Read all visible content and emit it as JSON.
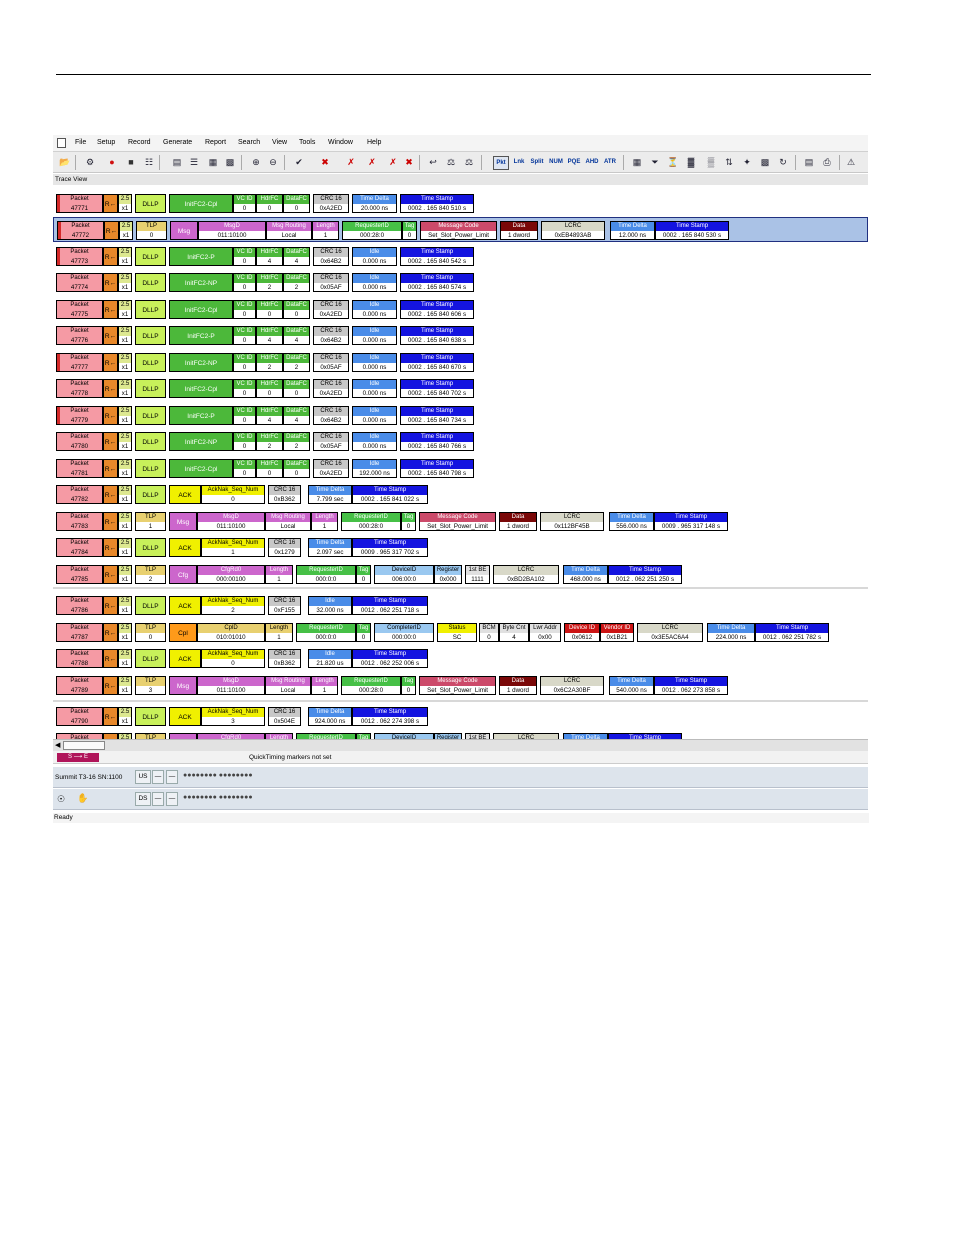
{
  "menu": [
    "File",
    "Setup",
    "Record",
    "Generate",
    "Report",
    "Search",
    "View",
    "Tools",
    "Window",
    "Help"
  ],
  "toolbar": {
    "text_buttons": [
      "Pkt",
      "Lnk",
      "Split",
      "NUM",
      "PQE",
      "AHD",
      "ATR"
    ]
  },
  "trace_view_title": "Trace View",
  "headers": {
    "packet": "Packet",
    "vc_id": "VC ID",
    "hdr_fc": "HdrFC",
    "data_fc": "DataFC",
    "crc16": "CRC 16",
    "time_delta": "Time Delta",
    "time_stamp": "Time Stamp",
    "idle": "Idle",
    "msg_d": "MsgD",
    "msg_routing": "Msg Routing",
    "length": "Length",
    "requester_id": "RequesterID",
    "tag": "Tag",
    "message_code": "Message Code",
    "data": "Data",
    "lcrc": "LCRC",
    "acknak_seq": "AckNak_Seq_Num",
    "cfgrd0": "CfgRd0",
    "device_id": "DeviceID",
    "register": "Register",
    "first_be": "1st BE",
    "cpl_d": "CplD",
    "completer_id": "CompleterID",
    "status": "Status",
    "bcm": "BCM",
    "byte_cnt": "Byte Cnt",
    "lwr_addr": "Lwr Addr",
    "device_id2": "Device ID",
    "vendor_id": "Vendor ID"
  },
  "labels": {
    "dir": "R←",
    "speed": "2.5",
    "width": "x1",
    "dllp": "DLLP",
    "tlp": "TLP",
    "ack": "ACK",
    "msg": "Msg",
    "cfg": "Cfg",
    "cpl": "Cpl",
    "dword_unit": "dword"
  },
  "fc_rows": [
    {
      "packet": "47771",
      "type": "InitFC2-Cpl",
      "vc": "0",
      "hdr": "0",
      "data": "0",
      "crc": "0xA2ED",
      "delta": "20.000 ns",
      "stamp": "0002 . 165 840 510 s",
      "delta_label": "Time Delta"
    },
    {
      "packet": "47773",
      "type": "InitFC2-P",
      "vc": "0",
      "hdr": "4",
      "data": "4",
      "crc": "0x64B2",
      "delta": "0.000 ns",
      "stamp": "0002 . 165 840 542 s",
      "delta_label": "Idle"
    },
    {
      "packet": "47774",
      "type": "InitFC2-NP",
      "vc": "0",
      "hdr": "2",
      "data": "2",
      "crc": "0x05AF",
      "delta": "0.000 ns",
      "stamp": "0002 . 165 840 574 s",
      "delta_label": "Idle"
    },
    {
      "packet": "47775",
      "type": "InitFC2-Cpl",
      "vc": "0",
      "hdr": "0",
      "data": "0",
      "crc": "0xA2ED",
      "delta": "0.000 ns",
      "stamp": "0002 . 165 840 606 s",
      "delta_label": "Idle"
    },
    {
      "packet": "47776",
      "type": "InitFC2-P",
      "vc": "0",
      "hdr": "4",
      "data": "4",
      "crc": "0x64B2",
      "delta": "0.000 ns",
      "stamp": "0002 . 165 840 638 s",
      "delta_label": "Idle"
    },
    {
      "packet": "47777",
      "type": "InitFC2-NP",
      "vc": "0",
      "hdr": "2",
      "data": "2",
      "crc": "0x05AF",
      "delta": "0.000 ns",
      "stamp": "0002 . 165 840 670 s",
      "delta_label": "Idle"
    },
    {
      "packet": "47778",
      "type": "InitFC2-Cpl",
      "vc": "0",
      "hdr": "0",
      "data": "0",
      "crc": "0xA2ED",
      "delta": "0.000 ns",
      "stamp": "0002 . 165 840 702 s",
      "delta_label": "Idle"
    },
    {
      "packet": "47779",
      "type": "InitFC2-P",
      "vc": "0",
      "hdr": "4",
      "data": "4",
      "crc": "0x64B2",
      "delta": "0.000 ns",
      "stamp": "0002 . 165 840 734 s",
      "delta_label": "Idle"
    },
    {
      "packet": "47780",
      "type": "InitFC2-NP",
      "vc": "0",
      "hdr": "2",
      "data": "2",
      "crc": "0x05AF",
      "delta": "0.000 ns",
      "stamp": "0002 . 165 840 766 s",
      "delta_label": "Idle"
    },
    {
      "packet": "47781",
      "type": "InitFC2-Cpl",
      "vc": "0",
      "hdr": "0",
      "data": "0",
      "crc": "0xA2ED",
      "delta": "192.000 ns",
      "stamp": "0002 . 165 840 798 s",
      "delta_label": "Idle"
    }
  ],
  "msg_rows": [
    {
      "packet": "47772",
      "tlp": "0",
      "msgd": "011:10100",
      "routing": "Local",
      "length": "1",
      "req": "000:28:0",
      "tag": "0",
      "code": "Set_Slot_Power_Limit",
      "data": "1",
      "lcrc": "0xEB4893AB",
      "delta": "12.000 ns",
      "stamp": "0002 . 165 840 530 s"
    },
    {
      "packet": "47783",
      "tlp": "1",
      "msgd": "011:10100",
      "routing": "Local",
      "length": "1",
      "req": "000:28:0",
      "tag": "0",
      "code": "Set_Slot_Power_Limit",
      "data": "1",
      "lcrc": "0x112BF45B",
      "delta": "556.000 ns",
      "stamp": "0009 . 965 317 148 s"
    },
    {
      "packet": "47789",
      "tlp": "3",
      "msgd": "011:10100",
      "routing": "Local",
      "length": "1",
      "req": "000:28:0",
      "tag": "0",
      "code": "Set_Slot_Power_Limit",
      "data": "1",
      "lcrc": "0x6C2A30BF",
      "delta": "540.000 ns",
      "stamp": "0012 . 062 273 858 s"
    }
  ],
  "ack_rows": [
    {
      "packet": "47782",
      "seq": "0",
      "crc": "0xB362",
      "delta": "7.799 sec",
      "stamp": "0002 . 165 841 022 s",
      "delta_label": "Time Delta"
    },
    {
      "packet": "47784",
      "seq": "1",
      "crc": "0x1279",
      "delta": "2.097 sec",
      "stamp": "0009 . 965 317 702 s",
      "delta_label": "Time Delta"
    },
    {
      "packet": "47786",
      "seq": "2",
      "crc": "0xF155",
      "delta": "32.000 ns",
      "stamp": "0012 . 062 251 718 s",
      "delta_label": "Idle"
    },
    {
      "packet": "47788",
      "seq": "0",
      "crc": "0xB362",
      "delta": "21.820 us",
      "stamp": "0012 . 062 252 006 s",
      "delta_label": "Idle"
    },
    {
      "packet": "47790",
      "seq": "3",
      "crc": "0x504E",
      "delta": "924.000 ns",
      "stamp": "0012 . 062 274 398 s",
      "delta_label": "Time Delta"
    }
  ],
  "cfg_row": {
    "packet": "47785",
    "tlp": "2",
    "cfgrd0": "000:00100",
    "length": "1",
    "req": "000:0:0",
    "tag": "0",
    "dev": "006:00:0",
    "reg": "0x000",
    "be": "1111",
    "lcrc": "0xBD2BA102",
    "delta": "468.000 ns",
    "stamp": "0012 . 062 251 250 s"
  },
  "cpl_row": {
    "packet": "47787",
    "tlp": "0",
    "cpld": "010:01010",
    "length": "1",
    "req": "000:0:0",
    "tag": "0",
    "comp": "000:00:0",
    "status": "SC",
    "bcm": "0",
    "bytecnt": "4",
    "lwr": "0x00",
    "devid": "0x0612",
    "vendid": "0x1B21",
    "lcrc": "0x3E5AC6A4",
    "delta": "224.000 ns",
    "stamp": "0012 . 062 251 782 s"
  },
  "status": {
    "se": "S ⟶ E",
    "quicktiming": "QuickTiming markers not set",
    "analyzer": "Summit T3-16 SN:1100",
    "us": "US",
    "ds": "DS",
    "dash": "—",
    "leds": "●●●●●●●● ●●●●●●●●",
    "ready": "Ready"
  }
}
